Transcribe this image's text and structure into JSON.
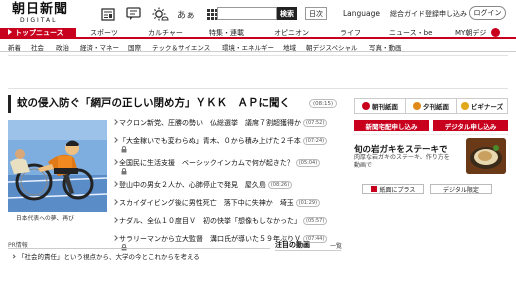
{
  "logo": {
    "main": "朝日新聞",
    "sub": "DIGITAL"
  },
  "header": {
    "tool_icons": [
      "newspaper-icon",
      "message-icon",
      "weather-icon",
      "font-size-icon",
      "grid-menu-icon"
    ],
    "font_label": "あぁ",
    "search_placeholder": "",
    "search_button": "検索",
    "japanese_button": "日次",
    "language_link": "Language",
    "sogo_link": "総合ガイド",
    "register_link": "登録申し込み",
    "login_button": "ログイン"
  },
  "nav_main": [
    {
      "label": "トップニュース",
      "active": true
    },
    {
      "label": "スポーツ",
      "active": false
    },
    {
      "label": "カルチャー",
      "active": false
    },
    {
      "label": "特集・連載",
      "active": false
    },
    {
      "label": "オピニオン",
      "active": false
    },
    {
      "label": "ライフ",
      "active": false
    },
    {
      "label": "ニュース・be",
      "active": false
    },
    {
      "label": "MY朝デジ",
      "active": false
    }
  ],
  "nav_sub": [
    "新着",
    "社会",
    "政治",
    "経済・マネー",
    "国際",
    "テック＆サイエンス",
    "環境・エネルギー",
    "地域",
    "朝デジスペシャル",
    "写真・動画"
  ],
  "headline": {
    "text": "蚊の侵入防ぐ「網戸の正しい閉め方」ＹＫＫ　ＡＰに聞く",
    "time": "(08:15)"
  },
  "photo_caption": "日本代表への夢、再び",
  "news": [
    {
      "text": "マクロン新党、圧勝の勢い　仏総選挙　議席７割超獲得か",
      "time": "(07:52)",
      "lock": false
    },
    {
      "text": "「大金稼いでも変わらぬ」青木、０から積み上げた２千本",
      "time": "(07:24)",
      "lock": true
    },
    {
      "text": "全国民に生活支援　ベーシックインカムで何が起きた？",
      "time": "(05:04)",
      "lock": true
    },
    {
      "text": "登山中の男女２人か、心肺停止で発見　屋久島",
      "time": "(08:26)",
      "lock": false
    },
    {
      "text": "スカイダイビング後に男性死亡　落下中に失神か　埼玉",
      "time": "(01:29)",
      "lock": false
    },
    {
      "text": "ナダル、全仏１０度目Ｖ　初の快挙「想像もしなかった」",
      "time": "(05:57)",
      "lock": false
    },
    {
      "text": "サラリーマンから立大監督　溝口氏が導いた５９年ぶりＶ",
      "time": "(07:44)",
      "lock": true
    }
  ],
  "pr": {
    "label": "PR情報",
    "text": "「社会的責任」という視点から、大学の今とこれからを考える"
  },
  "movies": {
    "title": "注目の動画",
    "list_link": "一覧"
  },
  "right": {
    "tabs": [
      {
        "icon": "morning-paper-icon",
        "label": "朝刊紙面"
      },
      {
        "icon": "evening-paper-icon",
        "label": "夕刊紙面"
      },
      {
        "icon": "business-icon",
        "label": "ビギナーズ"
      }
    ],
    "btn_newspaper": "新聞宅配申し込み",
    "btn_digital": "デジタル申し込み",
    "card_title": "旬の岩ガキをステーキで",
    "card_text": "肉厚な岩ガキのステーキ、作り方を動画で",
    "btn_plus": "紙面にプラス",
    "btn_limited": "デジタル限定"
  },
  "colors": {
    "brand_red": "#c8001e"
  }
}
